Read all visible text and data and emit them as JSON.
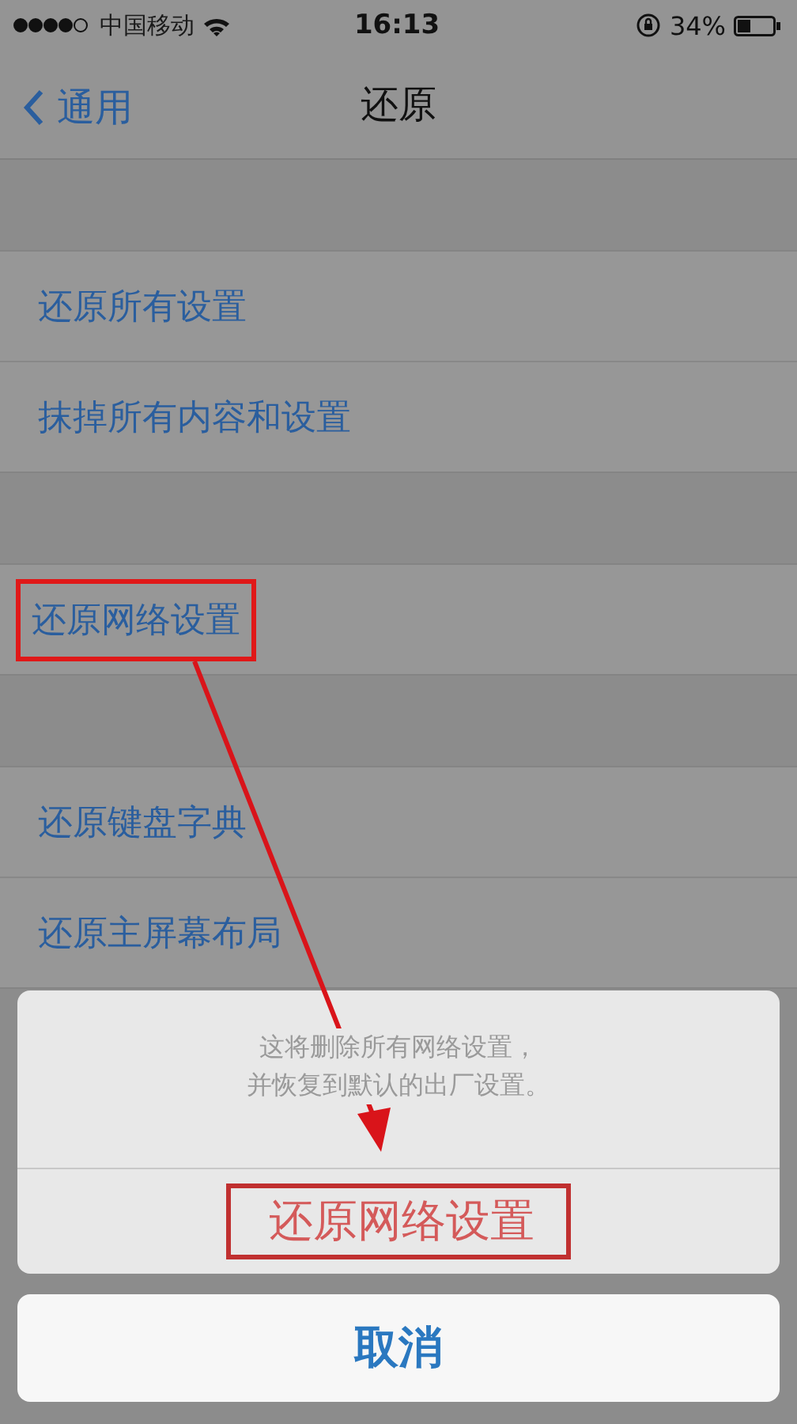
{
  "status_bar": {
    "carrier": "中国移动",
    "time": "16:13",
    "battery": "34%"
  },
  "nav": {
    "back": "通用",
    "title": "还原"
  },
  "groups": [
    {
      "rows": [
        {
          "label": "还原所有设置",
          "highlighted": false
        },
        {
          "label": "抹掉所有内容和设置",
          "highlighted": false
        }
      ]
    },
    {
      "rows": [
        {
          "label": "还原网络设置",
          "highlighted": true
        }
      ]
    },
    {
      "rows": [
        {
          "label": "还原键盘字典",
          "highlighted": false
        },
        {
          "label": "还原主屏幕布局",
          "highlighted": false
        }
      ]
    }
  ],
  "action_sheet": {
    "message": [
      "这将删除所有网络设置，",
      "并恢复到默认的出厂设置。"
    ],
    "action": {
      "label": "还原网络设置",
      "highlighted": true
    },
    "cancel": "取消"
  },
  "arrow": true
}
